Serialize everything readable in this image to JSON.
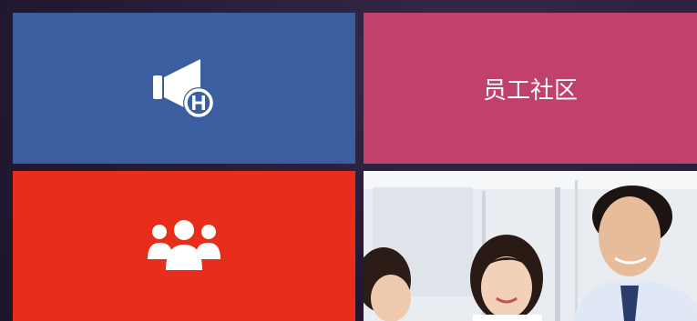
{
  "colors": {
    "announce_tile": "#3a5ea0",
    "community_tile": "#c0416c",
    "team_tile": "#e62e1a",
    "icon_fill": "#ffffff"
  },
  "tiles": {
    "announce": {
      "icon": "megaphone-h-icon"
    },
    "community": {
      "label": "员工社区"
    },
    "team": {
      "icon": "group-people-icon"
    },
    "photo": {
      "icon": "office-staff-photo"
    }
  }
}
